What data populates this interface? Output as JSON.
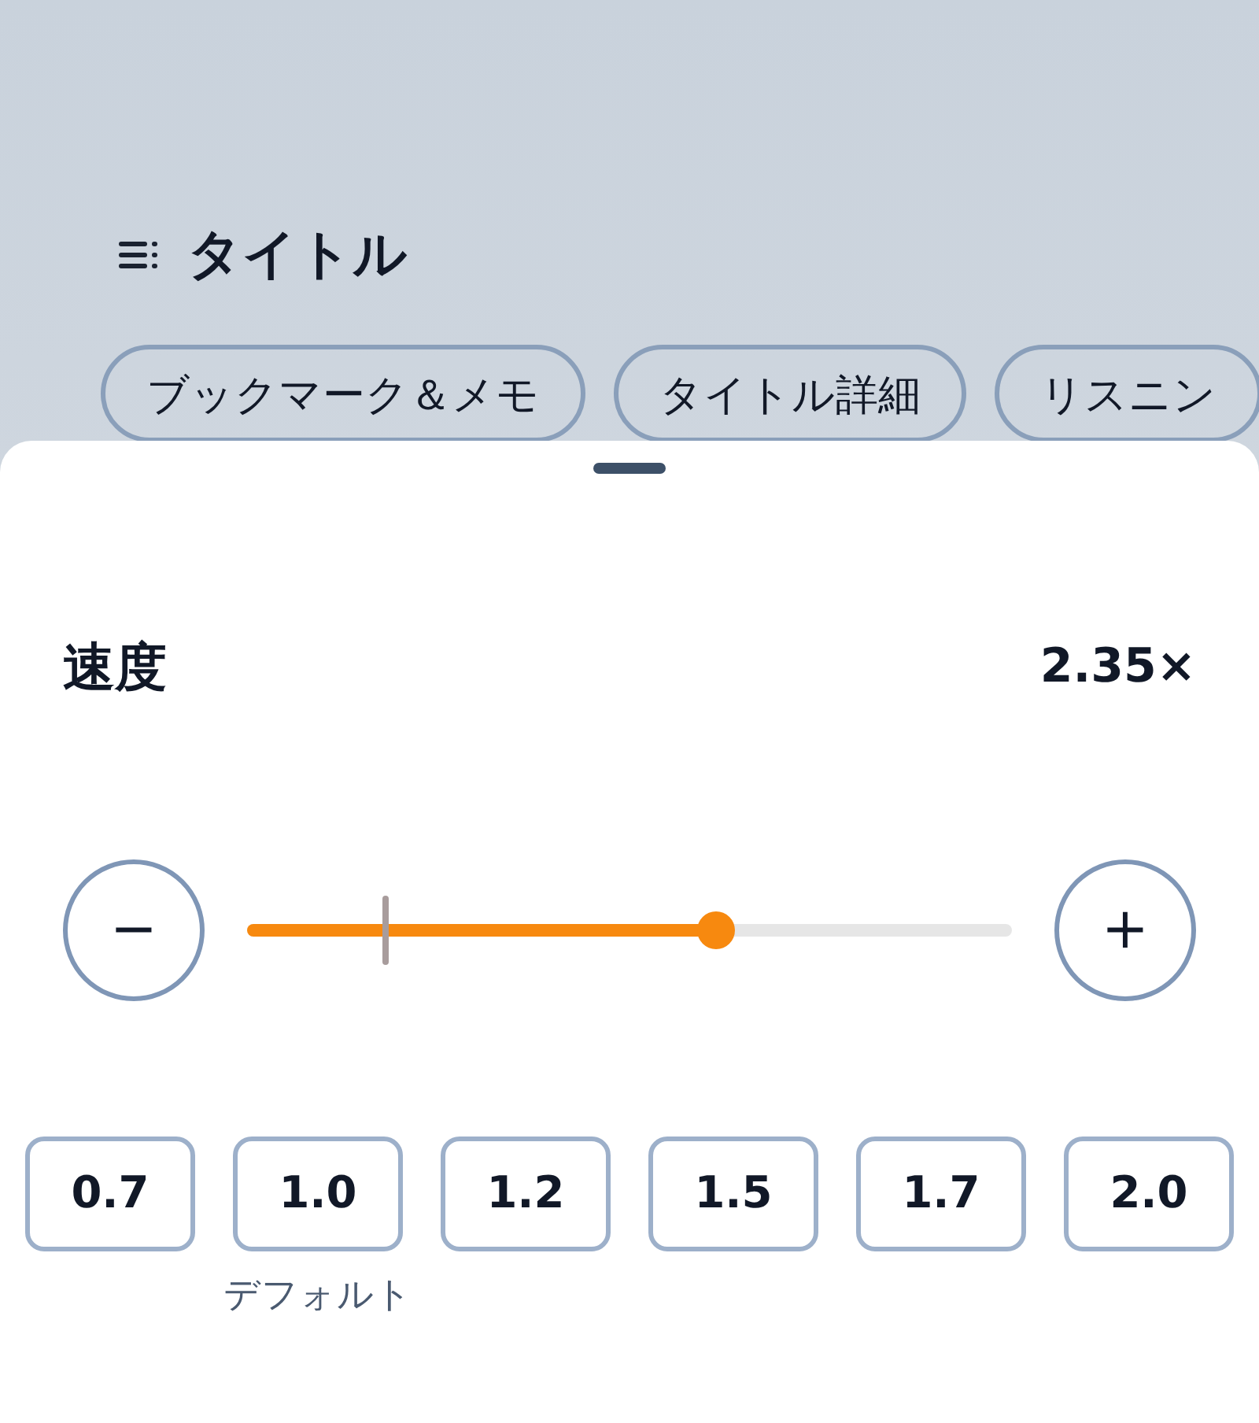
{
  "header": {
    "title": "タイトル"
  },
  "chips": [
    {
      "label": "ブックマーク＆メモ"
    },
    {
      "label": "タイトル詳細"
    },
    {
      "label": "リスニン"
    }
  ],
  "speed": {
    "label": "速度",
    "value": "2.35×",
    "minus": "−",
    "plus": "+",
    "level": 0.613
  },
  "presets": [
    {
      "label": "0.7"
    },
    {
      "label": "1.0",
      "note": "デフォルト"
    },
    {
      "label": "1.2"
    },
    {
      "label": "1.5"
    },
    {
      "label": "1.7"
    },
    {
      "label": "2.0"
    }
  ]
}
